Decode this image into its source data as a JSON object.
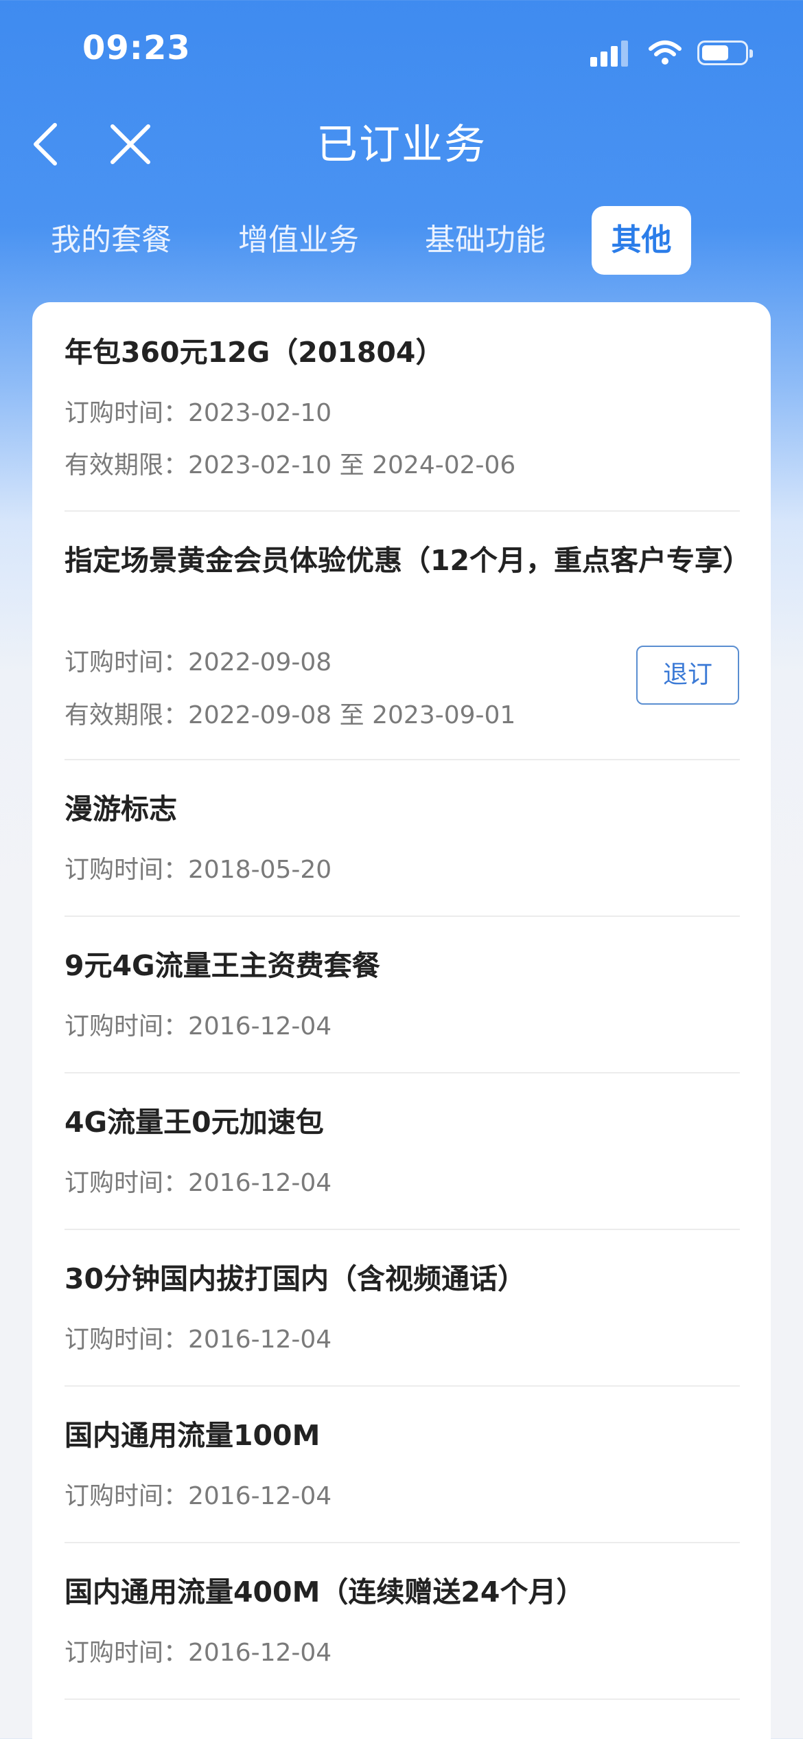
{
  "status_bar": {
    "time": "09:23"
  },
  "nav": {
    "title": "已订业务"
  },
  "tabs": [
    {
      "label": "我的套餐",
      "active": false
    },
    {
      "label": "增值业务",
      "active": false
    },
    {
      "label": "基础功能",
      "active": false
    },
    {
      "label": "其他",
      "active": true
    }
  ],
  "items": [
    {
      "name": "年包360元12G（201804）",
      "order_time": "订购时间：2023-02-10",
      "validity": "有效期限：2023-02-10 至 2024-02-06"
    },
    {
      "name": "指定场景黄金会员体验优惠（12个月，重点客户专享）",
      "order_time": "订购时间：2022-09-08",
      "validity": "有效期限：2022-09-08 至 2023-09-01",
      "action": "退订"
    },
    {
      "name": "漫游标志",
      "order_time": "订购时间：2018-05-20"
    },
    {
      "name": "9元4G流量王主资费套餐",
      "order_time": "订购时间：2016-12-04"
    },
    {
      "name": "4G流量王0元加速包",
      "order_time": "订购时间：2016-12-04"
    },
    {
      "name": "30分钟国内拔打国内（含视频通话）",
      "order_time": "订购时间：2016-12-04"
    },
    {
      "name": "国内通用流量100M",
      "order_time": "订购时间：2016-12-04"
    },
    {
      "name": "国内通用流量400M（连续赠送24个月）",
      "order_time": "订购时间：2016-12-04"
    }
  ],
  "colors": {
    "header_blue": "#4a93f2",
    "accent": "#2b7de9"
  },
  "icons": [
    "signal-icon",
    "wifi-icon",
    "battery-icon",
    "back-icon",
    "close-icon"
  ]
}
